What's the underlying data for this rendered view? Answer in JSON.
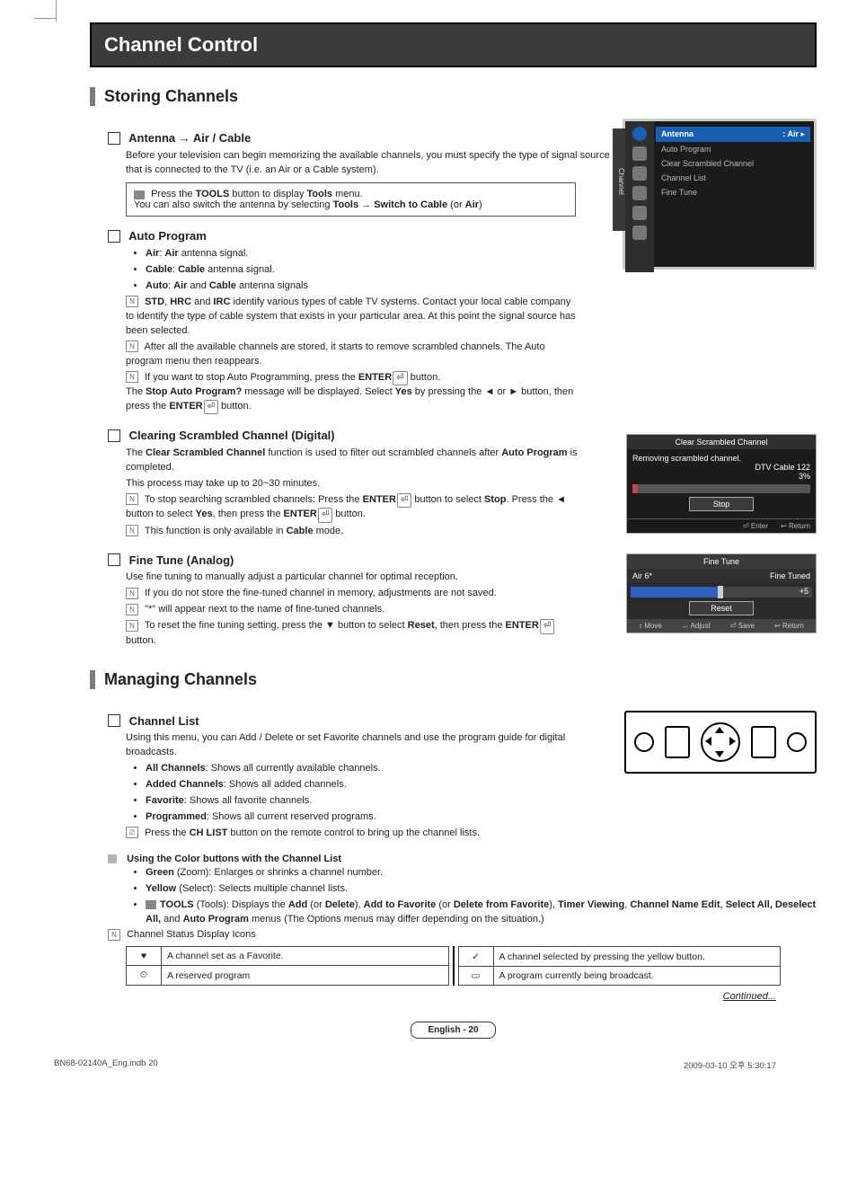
{
  "chapter": "Channel Control",
  "section1": "Storing Channels",
  "antenna": {
    "title": "Antenna → Air / Cable",
    "p1": "Before your television can begin memorizing the available channels, you must specify the type of signal source that is connected to the TV (i.e. an Air or a Cable system).",
    "callout1a": "Press the ",
    "callout1b": "TOOLS",
    "callout1c": " button to display ",
    "callout1d": "Tools",
    "callout1e": " menu.",
    "callout2a": "You can also switch the antenna by selecting ",
    "callout2b": "Tools → Switch to Cable",
    "callout2c": " (or ",
    "callout2d": "Air",
    "callout2e": ")"
  },
  "autoprog": {
    "title": "Auto Program",
    "b1a": "Air",
    "b1b": ": ",
    "b1c": "Air",
    "b1d": " antenna signal.",
    "b2a": "Cable",
    "b2b": ": ",
    "b2c": "Cable",
    "b2d": " antenna signal.",
    "b3a": "Auto",
    "b3b": ": ",
    "b3c": "Air",
    "b3d": " and ",
    "b3e": "Cable",
    "b3f": " antenna signals",
    "n1a": "STD",
    "n1b": ", ",
    "n1c": "HRC",
    "n1d": " and ",
    "n1e": "IRC",
    "n1f": " identify various types of cable TV systems. Contact your local cable company to identify the type of cable system that exists in your particular area. At this point the signal source has been selected.",
    "n2": "After all the available channels are stored, it starts to remove scrambled channels. The Auto program menu then reappears.",
    "n3a": "If you want to stop Auto Programming, press the ",
    "n3b": "ENTER",
    "n3c": " button.",
    "n3d": "The ",
    "n3e": "Stop Auto Program?",
    "n3f": " message will be displayed. Select ",
    "n3g": "Yes",
    "n3h": " by pressing the ◄ or ► button, then press the ",
    "n3i": "ENTER",
    "n3j": " button."
  },
  "clearing": {
    "title": "Clearing Scrambled Channel (Digital)",
    "p1a": "The ",
    "p1b": "Clear Scrambled Channel",
    "p1c": " function is used to filter out scrambled channels after ",
    "p1d": "Auto Program",
    "p1e": " is completed.",
    "p2": "This process may take up to 20~30 minutes.",
    "n1a": "To stop searching scrambled channels: Press the ",
    "n1b": "ENTER",
    "n1c": " button to select ",
    "n1d": "Stop",
    "n1e": ". Press the ◄ button to select ",
    "n1f": "Yes",
    "n1g": ", then press the ",
    "n1h": "ENTER",
    "n1i": " button.",
    "n2a": "This function is only available in ",
    "n2b": "Cable",
    "n2c": " mode."
  },
  "finetune": {
    "title": "Fine Tune (Analog)",
    "p1": "Use fine tuning to manually adjust a particular channel for optimal reception.",
    "n1": "If you do not store the fine-tuned channel in memory, adjustments are not saved.",
    "n2": "\"*\" will appear next to the name of fine-tuned channels.",
    "n3a": "To reset the fine tuning setting, press the ▼ button to select ",
    "n3b": "Reset",
    "n3c": ", then press the ",
    "n3d": "ENTER",
    "n3e": " button."
  },
  "section2": "Managing Channels",
  "chlist": {
    "title": "Channel List",
    "p1": "Using this menu, you can Add / Delete or set Favorite channels and use the program guide for digital broadcasts.",
    "b1a": "All Channels",
    "b1b": ": Shows all currently available channels.",
    "b2a": "Added Channels",
    "b2b": ": Shows all added channels.",
    "b3a": "Favorite",
    "b3b": ": Shows all favorite channels.",
    "b4a": "Programmed",
    "b4b": ": Shows all current reserved programs.",
    "n1a": "Press the ",
    "n1b": "CH LIST",
    "n1c": " button on the remote control to bring up the channel lists."
  },
  "color": {
    "title": "Using the Color buttons with the Channel List",
    "b1a": "Green",
    "b1b": " (Zoom): Enlarges or shrinks a channel number.",
    "b2a": "Yellow",
    "b2b": " (Select): Selects multiple channel lists.",
    "b3a": "TOOLS",
    "b3b": " (Tools): Displays the ",
    "b3c": "Add",
    "b3d": " (or ",
    "b3e": "Delete",
    "b3f": "), ",
    "b3g": "Add to Favorite",
    "b3h": " (or ",
    "b3i": "Delete from Favorite",
    "b3j": "), ",
    "b3k": "Timer Viewing",
    "b3l": ", ",
    "b3m": "Channel Name Edit",
    "b3n": ", ",
    "b3o": "Select All, Deselect All,",
    "b3p": " and ",
    "b3q": "Auto Program",
    "b3r": " menus (The Options menus may differ depending on the situation.)"
  },
  "statusTitle": "Channel Status Display Icons",
  "statusTable": {
    "r1c1": "♥",
    "r1c2": "A channel set as a Favorite.",
    "r2c1": "✓",
    "r2c2": "A channel selected by pressing the yellow button.",
    "r3c1": "⏲",
    "r3c2": "A reserved program",
    "r4c1": "▭",
    "r4c2": "A program currently being broadcast."
  },
  "osd1": {
    "side": "Channel",
    "highlight": "Antenna",
    "hval": ": Air",
    "i1": "Auto Program",
    "i2": "Clear Scrambled Channel",
    "i3": "Channel List",
    "i4": "Fine Tune"
  },
  "osd2": {
    "title": "Clear Scrambled Channel",
    "msg": "Removing scrambled channel.",
    "ch": "DTV Cable 122",
    "pct": "3%",
    "stop": "Stop",
    "enter": "Enter",
    "ret": "Return"
  },
  "osd3": {
    "title": "Fine Tune",
    "ch": "Air 6*",
    "tuned": "Fine Tuned",
    "val": "+5",
    "reset": "Reset",
    "f1": "Move",
    "f2": "Adjust",
    "f3": "Save",
    "f4": "Return"
  },
  "continued": "Continued...",
  "pagefoot": "English - 20",
  "footerL": "BN68-02140A_Eng.indb   20",
  "footerR": "2009-03-10   오후 5:30:17"
}
